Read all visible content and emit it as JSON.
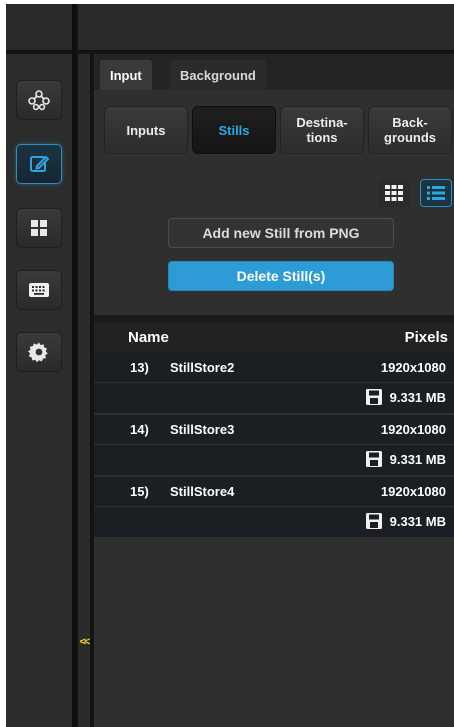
{
  "colors": {
    "accent": "#2d9bd6",
    "active_text": "#29a8e6",
    "collapse": "#f2d020"
  },
  "sidebar": {
    "items": [
      {
        "icon": "network-icon"
      },
      {
        "icon": "edit-icon"
      },
      {
        "icon": "grid-icon"
      },
      {
        "icon": "keyboard-icon"
      },
      {
        "icon": "gear-icon"
      }
    ]
  },
  "collapse_label": "<<",
  "tabs": [
    {
      "label": "Input"
    },
    {
      "label": "Background"
    }
  ],
  "subtabs": [
    {
      "label": "Inputs"
    },
    {
      "label": "Stills"
    },
    {
      "label_line1": "Destina-",
      "label_line2": "tions"
    },
    {
      "label_line1": "Back-",
      "label_line2": "grounds"
    }
  ],
  "actions": {
    "add_label": "Add new Still from PNG",
    "delete_label": "Delete Still(s)"
  },
  "table": {
    "col_name": "Name",
    "col_pixels": "Pixels",
    "rows": [
      {
        "index": "13)",
        "name": "StillStore2",
        "resolution": "1920x1080",
        "size": "9.331 MB"
      },
      {
        "index": "14)",
        "name": "StillStore3",
        "resolution": "1920x1080",
        "size": "9.331 MB"
      },
      {
        "index": "15)",
        "name": "StillStore4",
        "resolution": "1920x1080",
        "size": "9.331 MB"
      }
    ]
  }
}
